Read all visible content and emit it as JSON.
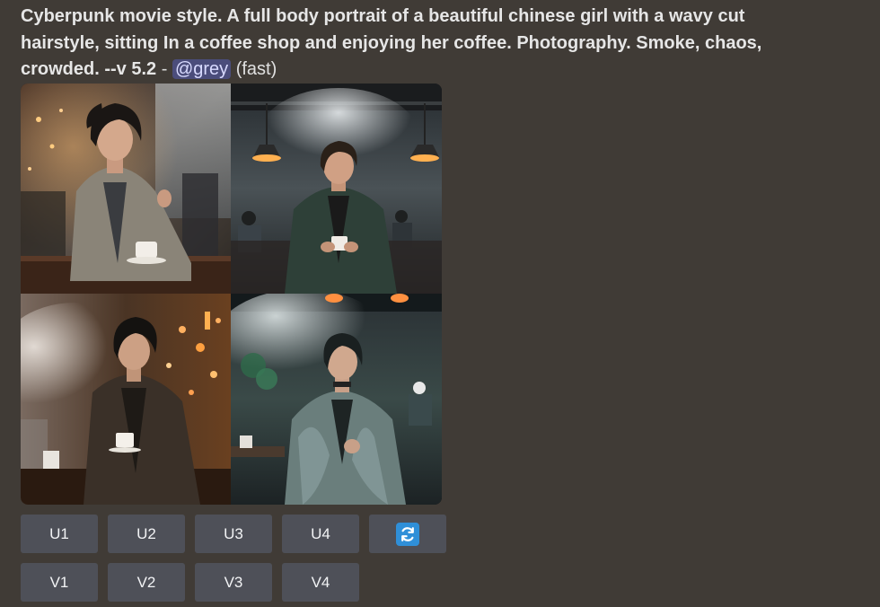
{
  "message": {
    "prompt": "Cyberpunk movie style. A full body portrait of a beautiful chinese girl with a wavy cut hairstyle, sitting In a coffee shop and enjoying her coffee. Photography. Smoke, chaos, crowded. --v 5.2",
    "separator": " - ",
    "mention": "@grey",
    "speed": "(fast)"
  },
  "image_grid": {
    "tiles": [
      {
        "name": "woman in trench coat holding coffee cup",
        "palette": {
          "bg": "#3a3530",
          "accent": "#c89a60"
        }
      },
      {
        "name": "woman in green cardigan in smoky cafe",
        "palette": {
          "bg": "#2e3336",
          "accent": "#e0a050"
        }
      },
      {
        "name": "woman in dark coat amid smoke",
        "palette": {
          "bg": "#4a3524",
          "accent": "#ffb070"
        }
      },
      {
        "name": "woman in shiny jacket in teal cafe",
        "palette": {
          "bg": "#2a3a3c",
          "accent": "#ff8840"
        }
      }
    ]
  },
  "buttons": {
    "upscale": [
      "U1",
      "U2",
      "U3",
      "U4"
    ],
    "variation": [
      "V1",
      "V2",
      "V3",
      "V4"
    ],
    "reroll_icon": "refresh-icon"
  },
  "colors": {
    "background": "#403b36",
    "button": "#4e5058",
    "mention_bg": "#4b4d7b",
    "refresh_blue": "#2f8fd8"
  }
}
